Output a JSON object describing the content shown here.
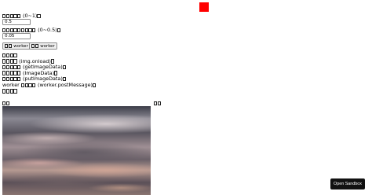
{
  "header": {
    "indicator_color": "#ff0000"
  },
  "controls": {
    "brightness_label": "(0~1)",
    "brightness_value": "0.5",
    "threshold_label": "(0~0.5)",
    "threshold_value": "0.05",
    "button_one_label": "worker",
    "button_two_label": "worker"
  },
  "performance": {
    "load_label": "(img.onload)",
    "get_label": "(getImageData)",
    "image_data_label": "(ImageData)",
    "put_label": "(putImageData)",
    "worker_prefix": "worker",
    "worker_label": "(worker.postMessage)"
  },
  "sandbox": {
    "label": "Open Sandbox"
  }
}
